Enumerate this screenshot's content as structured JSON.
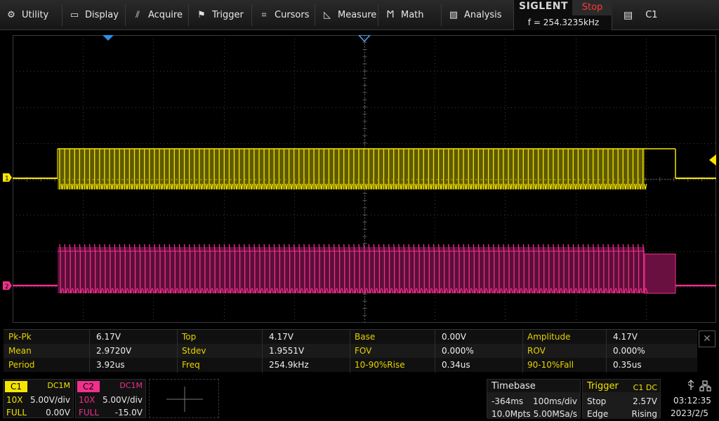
{
  "menu": [
    {
      "label": "Utility",
      "icon": "gear-icon",
      "glyph": "⚙"
    },
    {
      "label": "Display",
      "icon": "monitor-icon",
      "glyph": "▭"
    },
    {
      "label": "Acquire",
      "icon": "acquire-icon",
      "glyph": "⫽"
    },
    {
      "label": "Trigger",
      "icon": "flag-icon",
      "glyph": "⚑"
    },
    {
      "label": "Cursors",
      "icon": "crosshair-icon",
      "glyph": "⌗"
    },
    {
      "label": "Measure",
      "icon": "measure-icon",
      "glyph": "◺"
    },
    {
      "label": "Math",
      "icon": "math-icon",
      "glyph": "Ϻ"
    },
    {
      "label": "Analysis",
      "icon": "analysis-icon",
      "glyph": "▧"
    }
  ],
  "brand": "SIGLENT",
  "run_state": "Stop",
  "frequency": "f = 254.3235kHz",
  "channel_select": {
    "label": "C1",
    "glyph": "▤"
  },
  "measurements": [
    [
      {
        "label": "Pk-Pk",
        "value": "6.17V"
      },
      {
        "label": "Top",
        "value": "4.17V"
      },
      {
        "label": "Base",
        "value": "0.00V"
      },
      {
        "label": "Amplitude",
        "value": "4.17V"
      }
    ],
    [
      {
        "label": "Mean",
        "value": "2.9720V"
      },
      {
        "label": "Stdev",
        "value": "1.9551V"
      },
      {
        "label": "FOV",
        "value": "0.000%"
      },
      {
        "label": "ROV",
        "value": "0.000%"
      }
    ],
    [
      {
        "label": "Period",
        "value": "3.92us"
      },
      {
        "label": "Freq",
        "value": "254.9kHz"
      },
      {
        "label": "10-90%Rise",
        "value": "0.34us"
      },
      {
        "label": "90-10%Fall",
        "value": "0.35us"
      }
    ]
  ],
  "close_glyph": "✕",
  "ch1": {
    "name": "C1",
    "coupling": "DC1M",
    "probe": "10X",
    "scale": "5.00V/div",
    "bw": "FULL",
    "offset": "0.00V",
    "color": "#f5e400"
  },
  "ch2": {
    "name": "C2",
    "coupling": "DC1M",
    "probe": "10X",
    "scale": "5.00V/div",
    "bw": "FULL",
    "offset": "-15.0V",
    "color": "#f0308c"
  },
  "timebase": {
    "title": "Timebase",
    "delay": "-364ms",
    "scale": "100ms/div",
    "memory": "10.0Mpts",
    "rate": "5.00MSa/s"
  },
  "trigger": {
    "title": "Trigger",
    "source": "C1 DC",
    "state": "Stop",
    "level": "2.57V",
    "type": "Edge",
    "slope": "Rising"
  },
  "clock": {
    "time": "03:12:35",
    "date": "2023/2/5"
  },
  "markers": {
    "ch1": "1",
    "ch2": "2"
  }
}
